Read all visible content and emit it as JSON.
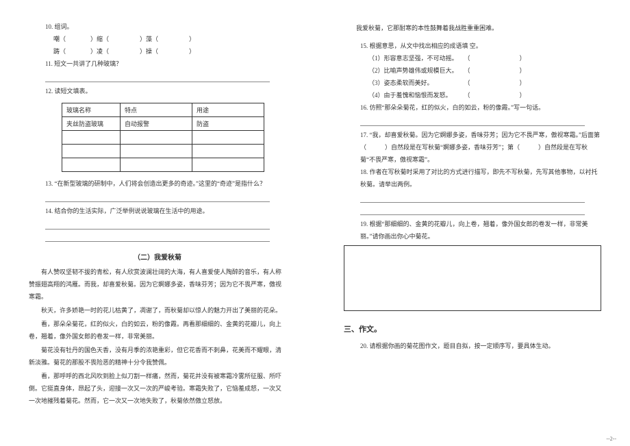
{
  "left": {
    "q10": "10. 组词。",
    "q10a": "嘲（　　　　）缩（　　　　　）藻（　　　　　）",
    "q10b": "踌（　　　　）凌（　　　　　）操（　　　　　）",
    "q11": "11. 短文一共讲了几种玻璃？",
    "q12": "12. 读短文填表。",
    "table": {
      "h1": "玻璃名称",
      "h2": "特点",
      "h3": "用途",
      "r1c1": "夹丝防盗玻璃",
      "r1c2": "自动报警",
      "r1c3": "防盗"
    },
    "q13": "13. “在新型玻璃的研制中，人们将会创造出更多的奇迹。”这里的“奇迹”是指什么？",
    "q14": "14. 结合你的生活实际，广泛举例说说玻璃在生活中的用途。",
    "title2": "（二）我爱秋菊",
    "p1": "有人赞叹坚韧不拔的青松，有人欣赏波澜壮阔的大海，有人喜爱使人陶醉的音乐，有人称赞振翅高翔的鸿雁。而我，却喜爱秋菊。因为它婀娜多姿，香味芬芳；因为它不畏严寒，傲视寒霜。",
    "p2": "秋天，许多娇艳一时的花儿枯黄了，凋谢了，而秋菊却以惊人的魅力开出了美丽的花朵。",
    "p3": "看，那朵朵菊花，红的似火，白的如云，粉的像霞。再看那细细的、金黄的花瓣儿，向上卷，翘着，像外国女郎的卷发一样，非常美丽。",
    "p4": "菊花没有牡丹的国色天香，没有月季的浓艳重彩，但它花香而不刺鼻，花美而不耀眼，清新淡雅。菊花的那股不畏险恶的精神十分令我赞佩。",
    "p5": "看，那呼呼的西北风吹到脸上似刀割一样痛，然而，菊花并没有被寒霜冷雾所征服、所吓倒。它挺直身体，昂起了头，迎接一次又一次的严峻考验。寒霜失败了，它恼羞成怒，一次又一次地摧残着菊花。然而，它一次又一次地失败了，秋菊依然傲立怒放。"
  },
  "right": {
    "p6": "我爱秋菊，它那耐寒的本性鼓舞着我战胜重重困难。",
    "q15": "15. 根据意思，从文中找出相应的成语填  空。",
    "q15a": "（1）形容意志坚强，不可动摇。　　（　　　　　　　　）",
    "q15b": "（2）比喻声势雄伟或规模巨大。　　（　　　　　　　　）",
    "q15c": "（3）姿态柔软而美好。　　　　　　（　　　　　　　　）",
    "q15d": "（4）由于羞愧和恼恨而发怒。　　　（　　　　　　　　）",
    "q16": "16. 仿照“那朵朵菊花，红的似火，白的如云，粉的像霞。”写一句话。",
    "q17": "17. “我，却喜爱秋菊。因为它婀娜多姿，香味芬芳；因为它不畏严寒，傲视寒霜。”后面第（　　　）自然段是在写秋菊“婀娜多姿，香味芬芳”；第（　　　）自然段是在写秋菊“不畏严寒，傲视寒霜”。",
    "q18": "18. 作者在写秋菊时采用了对比的方式进行描写，即先不写秋菊，先写其他事物，以衬托秋菊。请举出两例。",
    "q19": "19. 根据“那细细的、金黄的花瓣儿，向上卷，翘着，像外国女郎的卷发一样，非常美丽。”请你画出你心中菊花。",
    "sec3": "三、作文。",
    "q20": "20. 请根据你画的菊花图作文，题目自拟，按一定顺序写，要具体生动。",
    "pagenum": "--2--"
  }
}
